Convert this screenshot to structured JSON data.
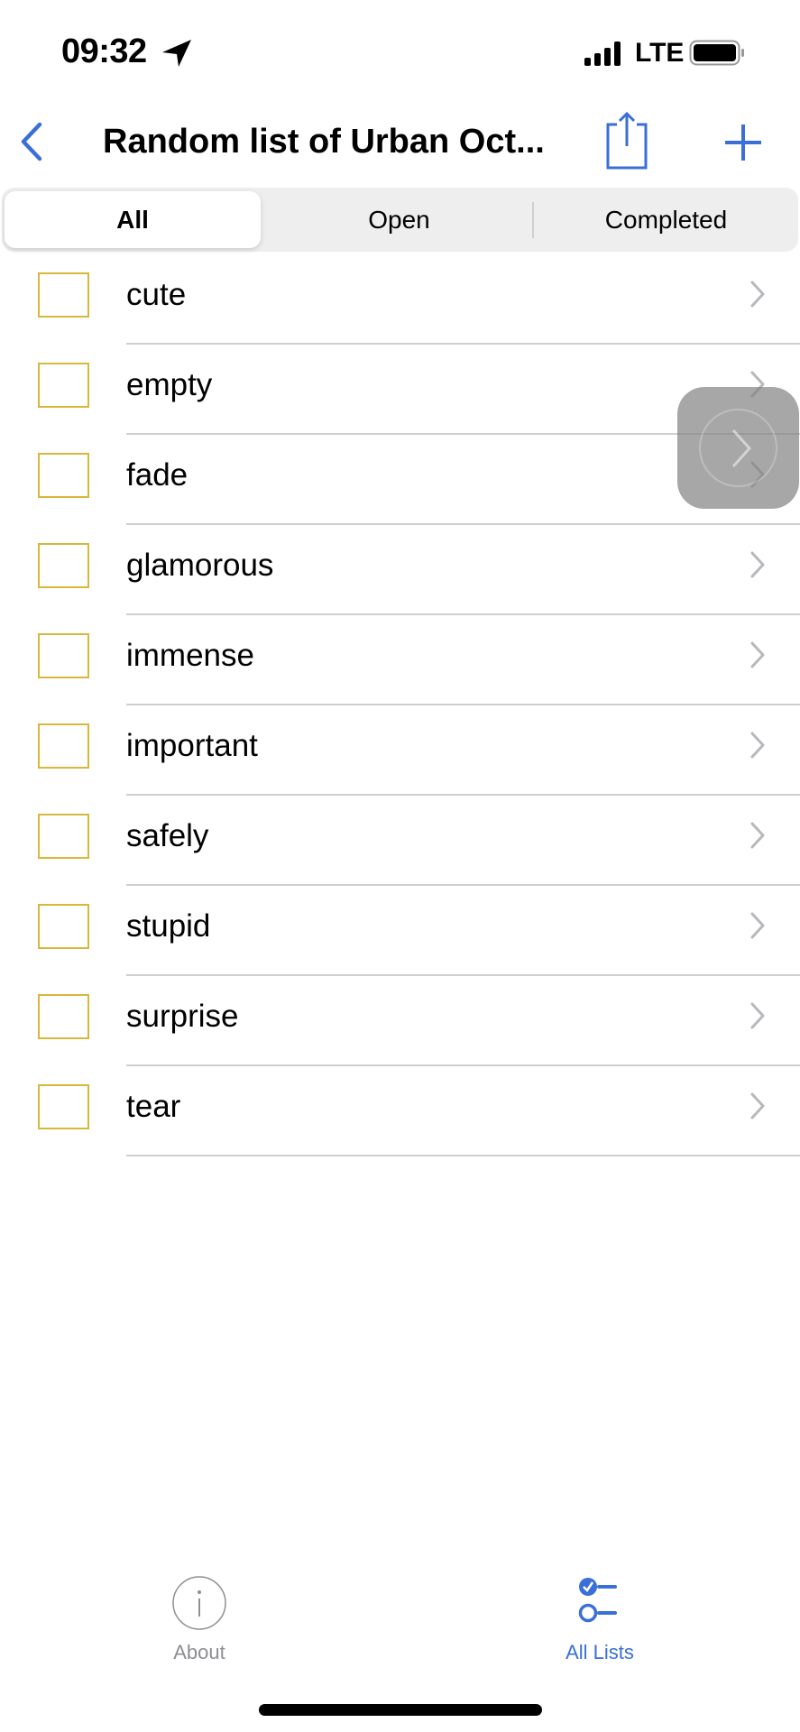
{
  "status": {
    "time": "09:32",
    "network": "LTE"
  },
  "nav": {
    "title": "Random list of Urban Oct..."
  },
  "segments": [
    "All",
    "Open",
    "Completed"
  ],
  "items": [
    "cute",
    "empty",
    "fade",
    "glamorous",
    "immense",
    "important",
    "safely",
    "stupid",
    "surprise",
    "tear"
  ],
  "tabbar": {
    "about": "About",
    "all_lists": "All Lists"
  },
  "colors": {
    "accent": "#3a6fd8",
    "checkbox": "#d8b73c"
  }
}
